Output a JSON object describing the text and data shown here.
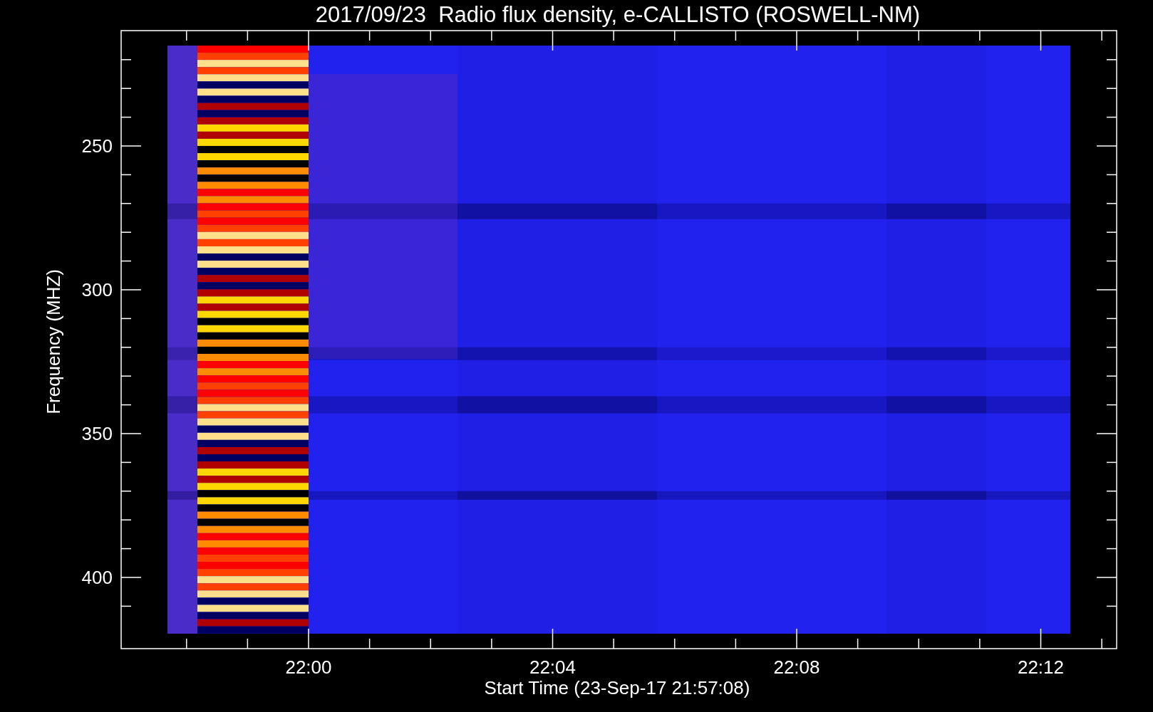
{
  "plot": {
    "title": "2017/09/23  Radio flux density, e-CALLISTO (ROSWELL-NM)",
    "ylabel": "Frequency (MHZ)",
    "xlabel": "Start Time (23-Sep-17 21:57:08)",
    "yticks": [
      "250",
      "300",
      "350",
      "400"
    ],
    "xticks": [
      "22:00",
      "22:04",
      "22:08",
      "22:12"
    ]
  }
}
